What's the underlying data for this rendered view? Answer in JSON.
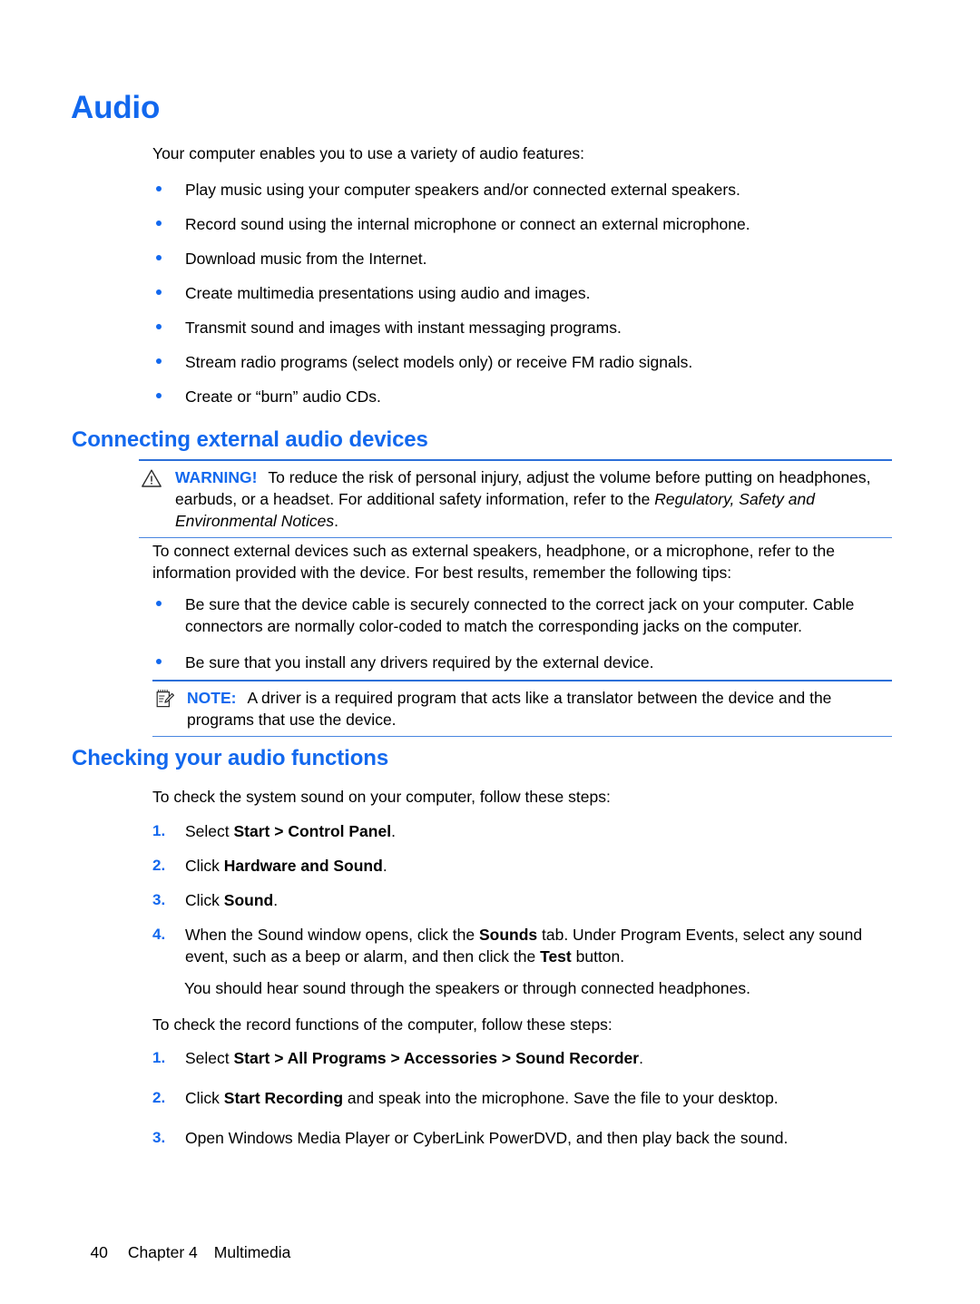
{
  "colors": {
    "heading_blue": "#1268EE",
    "rule_blue": "#2C6FD8",
    "rule_blue_light": "#4A86E0",
    "body_black": "#000000",
    "page_background": "#FFFFFF"
  },
  "page_title": "Audio",
  "intro_paragraph": "Your computer enables you to use a variety of audio features:",
  "audio_features": [
    "Play music using your computer speakers and/or connected external speakers.",
    "Record sound using the internal microphone or connect an external microphone.",
    "Download music from the Internet.",
    "Create multimedia presentations using audio and images.",
    "Transmit sound and images with instant messaging programs.",
    "Stream radio programs (select models only) or receive FM radio signals.",
    "Create or “burn” audio CDs."
  ],
  "connecting_section": {
    "heading": "Connecting external audio devices",
    "warning": {
      "icon": "warning-triangle-icon",
      "keyword": "WARNING!",
      "text_part1": "To reduce the risk of personal injury, adjust the volume before putting on headphones, earbuds, or a headset. For additional safety information, refer to the ",
      "text_italic": "Regulatory, Safety and Environmental Notices",
      "text_part2": "."
    },
    "paragraph": "To connect external devices such as external speakers, headphone, or a microphone, refer to the information provided with the device. For best results, remember the following tips:",
    "tips": [
      "Be sure that the device cable is securely connected to the correct jack on your computer. Cable connectors are normally color-coded to match the corresponding jacks on the computer.",
      "Be sure that you install any drivers required by the external device."
    ],
    "note": {
      "icon": "note-pad-icon",
      "keyword": "NOTE:",
      "text": "A driver is a required program that acts like a translator between the device and the programs that use the device."
    }
  },
  "checking_section": {
    "heading": "Checking your audio functions",
    "system_sound_intro": "To check the system sound on your computer, follow these steps:",
    "system_sound_steps": [
      {
        "number": "1.",
        "segments": [
          {
            "text": "Select ",
            "bold": false
          },
          {
            "text": "Start > Control Panel",
            "bold": true
          },
          {
            "text": ".",
            "bold": false
          }
        ]
      },
      {
        "number": "2.",
        "segments": [
          {
            "text": "Click ",
            "bold": false
          },
          {
            "text": "Hardware and Sound",
            "bold": true
          },
          {
            "text": ".",
            "bold": false
          }
        ]
      },
      {
        "number": "3.",
        "segments": [
          {
            "text": "Click ",
            "bold": false
          },
          {
            "text": "Sound",
            "bold": true
          },
          {
            "text": ".",
            "bold": false
          }
        ]
      },
      {
        "number": "4.",
        "segments": [
          {
            "text": "When the Sound window opens, click the ",
            "bold": false
          },
          {
            "text": "Sounds",
            "bold": true
          },
          {
            "text": " tab. Under Program Events, select any sound event, such as a beep or alarm, and then click the ",
            "bold": false
          },
          {
            "text": "Test",
            "bold": true
          },
          {
            "text": " button.",
            "bold": false
          }
        ]
      }
    ],
    "hear_sound_note": "You should hear sound through the speakers or through connected headphones.",
    "record_intro": "To check the record functions of the computer, follow these steps:",
    "record_steps": [
      {
        "number": "1.",
        "segments": [
          {
            "text": "Select ",
            "bold": false
          },
          {
            "text": "Start > All Programs > Accessories > Sound Recorder",
            "bold": true
          },
          {
            "text": ".",
            "bold": false
          }
        ]
      },
      {
        "number": "2.",
        "segments": [
          {
            "text": "Click ",
            "bold": false
          },
          {
            "text": "Start Recording",
            "bold": true
          },
          {
            "text": " and speak into the microphone. Save the file to your desktop.",
            "bold": false
          }
        ]
      },
      {
        "number": "3.",
        "segments": [
          {
            "text": "Open Windows Media Player or CyberLink PowerDVD, and then play back the sound.",
            "bold": false
          }
        ]
      }
    ]
  },
  "footer": {
    "page_number": "40",
    "chapter": "Chapter 4",
    "chapter_title": "Multimedia"
  }
}
